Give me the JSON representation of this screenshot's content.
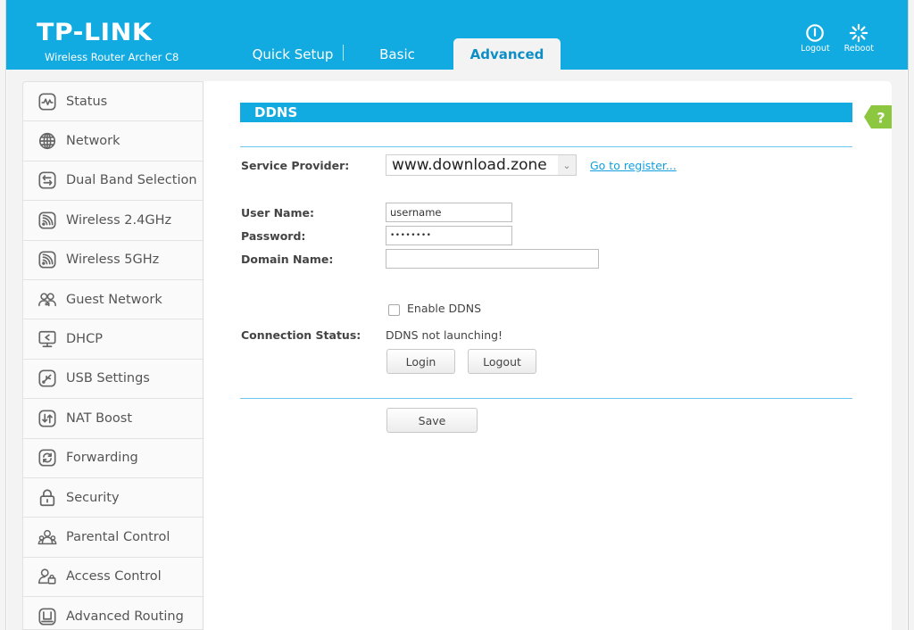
{
  "header": {
    "brand": "TP-LINK",
    "model": "Wireless Router Archer C8",
    "tabs": [
      {
        "label": "Quick Setup",
        "active": false
      },
      {
        "label": "Basic",
        "active": false
      },
      {
        "label": "Advanced",
        "active": true
      }
    ],
    "actions": [
      {
        "label": "Logout",
        "icon": "power-icon"
      },
      {
        "label": "Reboot",
        "icon": "reboot-icon"
      }
    ]
  },
  "sidebar": {
    "items": [
      {
        "label": "Status",
        "icon": "status-icon"
      },
      {
        "label": "Network",
        "icon": "globe-icon"
      },
      {
        "label": "Dual Band Selection",
        "icon": "dual-band-icon"
      },
      {
        "label": "Wireless 2.4GHz",
        "icon": "wireless-icon"
      },
      {
        "label": "Wireless 5GHz",
        "icon": "wireless-icon"
      },
      {
        "label": "Guest Network",
        "icon": "guest-network-icon"
      },
      {
        "label": "DHCP",
        "icon": "dhcp-icon"
      },
      {
        "label": "USB Settings",
        "icon": "usb-icon"
      },
      {
        "label": "NAT Boost",
        "icon": "nat-boost-icon"
      },
      {
        "label": "Forwarding",
        "icon": "forwarding-icon"
      },
      {
        "label": "Security",
        "icon": "lock-icon"
      },
      {
        "label": "Parental Control",
        "icon": "parental-control-icon"
      },
      {
        "label": "Access Control",
        "icon": "access-control-icon"
      },
      {
        "label": "Advanced Routing",
        "icon": "routing-icon"
      }
    ]
  },
  "main": {
    "section_title": "DDNS",
    "help_label": "?",
    "service_provider": {
      "label": "Service Provider:",
      "value": "www.download.zone",
      "register_link": "Go to register..."
    },
    "user_name": {
      "label": "User Name:",
      "value": "username"
    },
    "password": {
      "label": "Password:",
      "value": "••••••••"
    },
    "domain_name": {
      "label": "Domain Name:",
      "value": ""
    },
    "enable_ddns": {
      "label": "Enable DDNS",
      "checked": false
    },
    "connection_status": {
      "label": "Connection Status:",
      "value": "DDNS not launching!"
    },
    "buttons": {
      "login": "Login",
      "logout": "Logout",
      "save": "Save"
    }
  },
  "colors": {
    "brand_blue": "#11aae1",
    "help_green": "#8dc63f",
    "link_blue": "#11a0dd"
  }
}
